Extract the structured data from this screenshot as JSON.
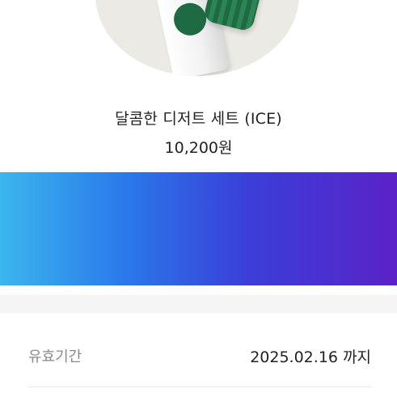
{
  "product": {
    "name": "달콤한 디저트 세트 (ICE)",
    "price": "10,200원"
  },
  "info": {
    "validity_label": "유효기간",
    "validity_value": "2025.02.16 까지"
  },
  "colors": {
    "gradient_start": "#3bb6ee",
    "gradient_mid": "#3a3fd8",
    "gradient_end": "#5a22c8",
    "accent_green": "#1e6b43"
  }
}
